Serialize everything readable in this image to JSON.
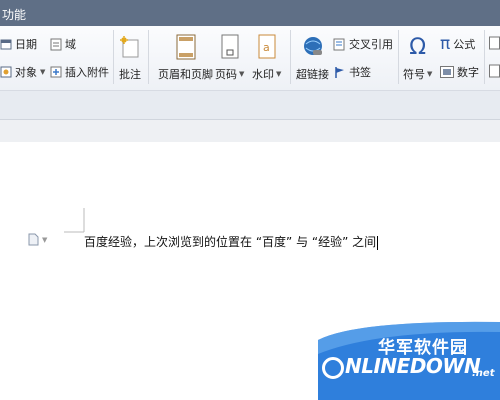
{
  "window": {
    "title": "功能"
  },
  "ribbon": {
    "date": "日期",
    "field": "域",
    "object": "对象",
    "insert_attachment": "插入附件",
    "comment": "批注",
    "header_footer": "页眉和页脚",
    "page_number": "页码",
    "watermark": "水印",
    "hyperlink": "超链接",
    "cross_reference": "交叉引用",
    "bookmark": "书签",
    "symbol": "符号",
    "formula": "公式",
    "number": "数字",
    "formula_symbol": "π",
    "symbol_glyph": "Ω"
  },
  "document": {
    "text": "百度经验，上次浏览到的位置在 “百度” 与 “经验” 之间"
  },
  "watermark": {
    "cn": "华军软件园",
    "en_rest": "NLINEDOWN",
    "net": ".net"
  },
  "colors": {
    "titlebar": "#5f6f86",
    "watermark_blue": "#2f7fdc",
    "arrow": "#d9534f"
  }
}
